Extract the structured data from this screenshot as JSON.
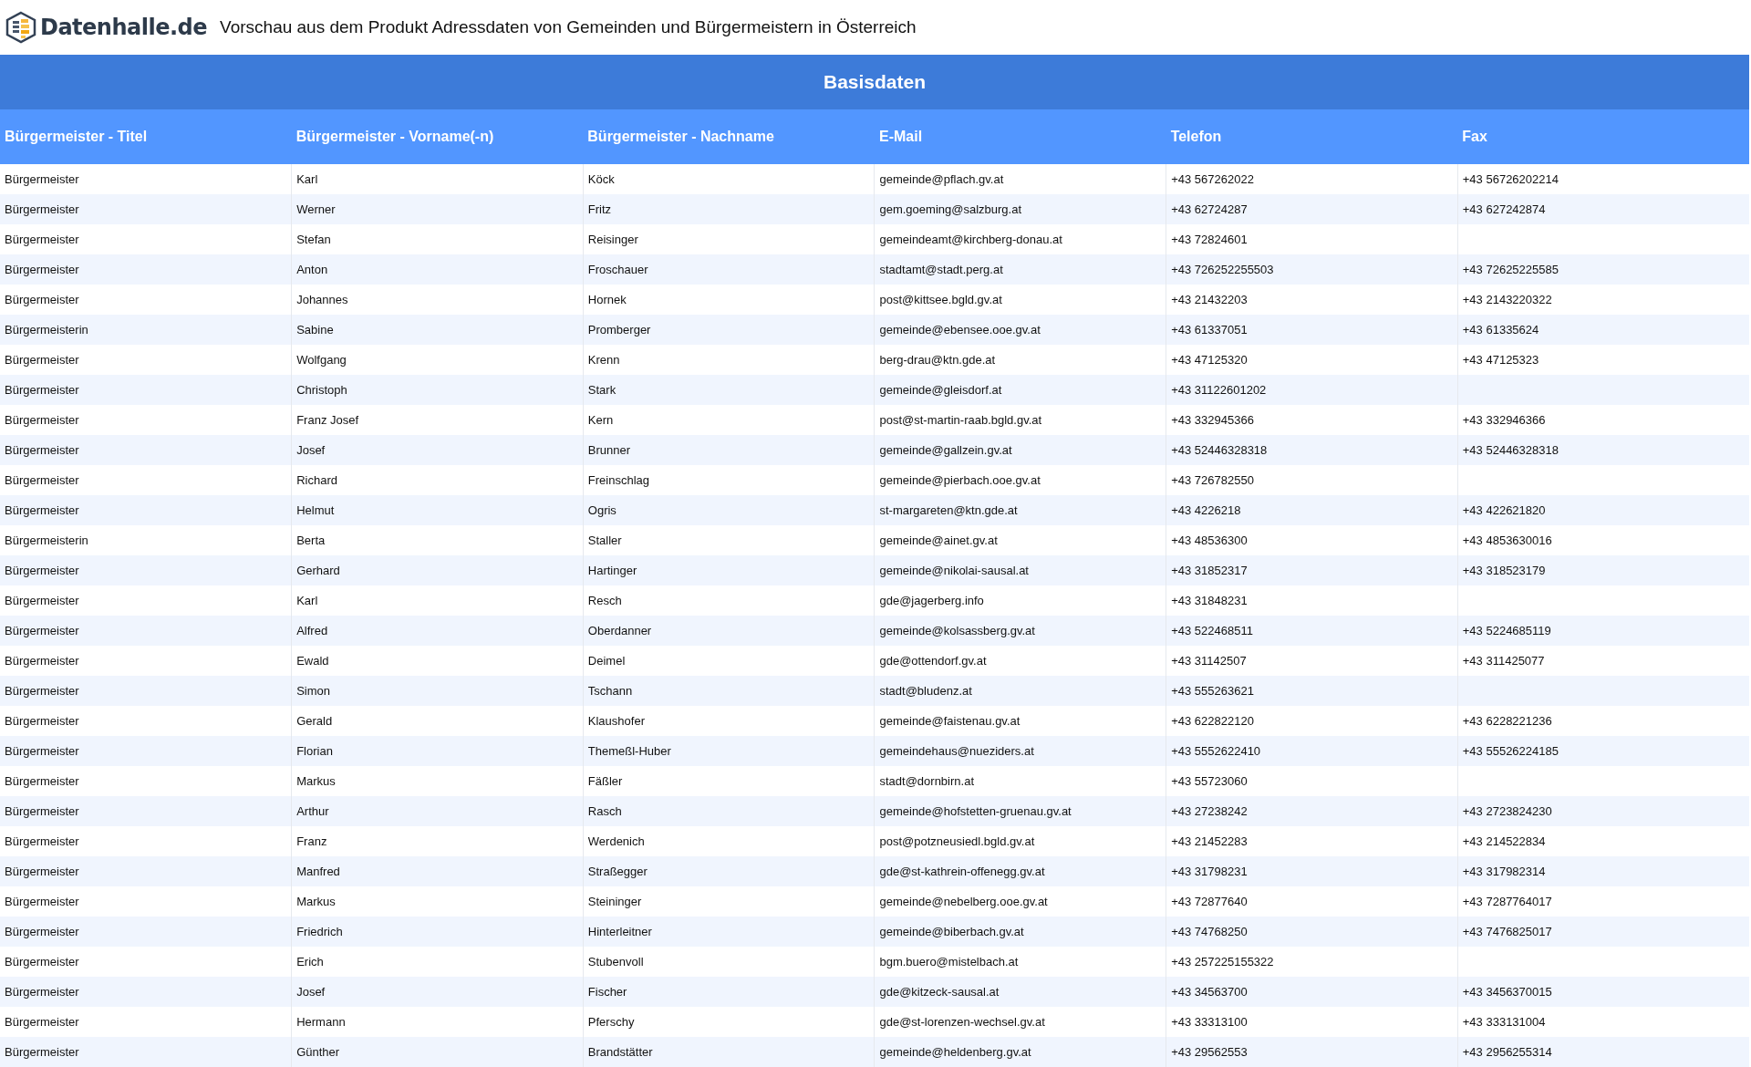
{
  "header": {
    "logo_text": "Datenhalle.de",
    "title": "Vorschau aus dem Produkt Adressdaten von Gemeinden und Bürgermeistern in Österreich"
  },
  "table": {
    "group_title": "Basisdaten",
    "columns": [
      "Bürgermeister - Titel",
      "Bürgermeister - Vorname(-n)",
      "Bürgermeister - Nachname",
      "E-Mail",
      "Telefon",
      "Fax"
    ],
    "rows": [
      [
        "Bürgermeister",
        "Karl",
        "Köck",
        "gemeinde@pflach.gv.at",
        "+43 567262022",
        "+43 56726202214"
      ],
      [
        "Bürgermeister",
        "Werner",
        "Fritz",
        "gem.goeming@salzburg.at",
        "+43 62724287",
        "+43 627242874"
      ],
      [
        "Bürgermeister",
        "Stefan",
        "Reisinger",
        "gemeindeamt@kirchberg-donau.at",
        "+43 72824601",
        null
      ],
      [
        "Bürgermeister",
        "Anton",
        "Froschauer",
        "stadtamt@stadt.perg.at",
        "+43 726252255503",
        "+43 72625225585"
      ],
      [
        "Bürgermeister",
        "Johannes",
        "Hornek",
        "post@kittsee.bgld.gv.at",
        "+43 21432203",
        "+43 2143220322"
      ],
      [
        "Bürgermeisterin",
        "Sabine",
        "Promberger",
        "gemeinde@ebensee.ooe.gv.at",
        "+43 61337051",
        "+43 61335624"
      ],
      [
        "Bürgermeister",
        "Wolfgang",
        "Krenn",
        "berg-drau@ktn.gde.at",
        "+43 47125320",
        "+43 47125323"
      ],
      [
        "Bürgermeister",
        "Christoph",
        "Stark",
        "gemeinde@gleisdorf.at",
        "+43 31122601202",
        null
      ],
      [
        "Bürgermeister",
        "Franz Josef",
        "Kern",
        "post@st-martin-raab.bgld.gv.at",
        "+43 332945366",
        "+43 332946366"
      ],
      [
        "Bürgermeister",
        "Josef",
        "Brunner",
        "gemeinde@gallzein.gv.at",
        "+43 52446328318",
        "+43 52446328318"
      ],
      [
        "Bürgermeister",
        "Richard",
        "Freinschlag",
        "gemeinde@pierbach.ooe.gv.at",
        "+43 726782550",
        null
      ],
      [
        "Bürgermeister",
        "Helmut",
        "Ogris",
        "st-margareten@ktn.gde.at",
        "+43 4226218",
        "+43 422621820"
      ],
      [
        "Bürgermeisterin",
        "Berta",
        "Staller",
        "gemeinde@ainet.gv.at",
        "+43 48536300",
        "+43 4853630016"
      ],
      [
        "Bürgermeister",
        "Gerhard",
        "Hartinger",
        "gemeinde@nikolai-sausal.at",
        "+43 31852317",
        "+43 318523179"
      ],
      [
        "Bürgermeister",
        "Karl",
        "Resch",
        "gde@jagerberg.info",
        "+43 31848231",
        null
      ],
      [
        "Bürgermeister",
        "Alfred",
        "Oberdanner",
        "gemeinde@kolsassberg.gv.at",
        "+43 522468511",
        "+43 5224685119"
      ],
      [
        "Bürgermeister",
        "Ewald",
        "Deimel",
        "gde@ottendorf.gv.at",
        "+43 31142507",
        "+43 311425077"
      ],
      [
        "Bürgermeister",
        "Simon",
        "Tschann",
        "stadt@bludenz.at",
        "+43 555263621",
        null
      ],
      [
        "Bürgermeister",
        "Gerald",
        "Klaushofer",
        "gemeinde@faistenau.gv.at",
        "+43 622822120",
        "+43 6228221236"
      ],
      [
        "Bürgermeister",
        "Florian",
        "Themeßl-Huber",
        "gemeindehaus@nueziders.at",
        "+43 5552622410",
        "+43 55526224185"
      ],
      [
        "Bürgermeister",
        "Markus",
        "Fäßler",
        "stadt@dornbirn.at",
        "+43 55723060",
        null
      ],
      [
        "Bürgermeister",
        "Arthur",
        "Rasch",
        "gemeinde@hofstetten-gruenau.gv.at",
        "+43 27238242",
        "+43 2723824230"
      ],
      [
        "Bürgermeister",
        "Franz",
        "Werdenich",
        "post@potzneusiedl.bgld.gv.at",
        "+43 21452283",
        "+43 214522834"
      ],
      [
        "Bürgermeister",
        "Manfred",
        "Straßegger",
        "gde@st-kathrein-offenegg.gv.at",
        "+43 31798231",
        "+43 317982314"
      ],
      [
        "Bürgermeister",
        "Markus",
        "Steininger",
        "gemeinde@nebelberg.ooe.gv.at",
        "+43 72877640",
        "+43 7287764017"
      ],
      [
        "Bürgermeister",
        "Friedrich",
        "Hinterleitner",
        "gemeinde@biberbach.gv.at",
        "+43 74768250",
        "+43 7476825017"
      ],
      [
        "Bürgermeister",
        "Erich",
        "Stubenvoll",
        "bgm.buero@mistelbach.at",
        "+43 257225155322",
        null
      ],
      [
        "Bürgermeister",
        "Josef",
        "Fischer",
        "gde@kitzeck-sausal.at",
        "+43 34563700",
        "+43 3456370015"
      ],
      [
        "Bürgermeister",
        "Hermann",
        "Pferschy",
        "gde@st-lorenzen-wechsel.gv.at",
        "+43 33313100",
        "+43 333131004"
      ],
      [
        "Bürgermeister",
        "Günther",
        "Brandstätter",
        "gemeinde@heldenberg.gv.at",
        "+43 29562553",
        "+43 2956255314"
      ]
    ]
  }
}
